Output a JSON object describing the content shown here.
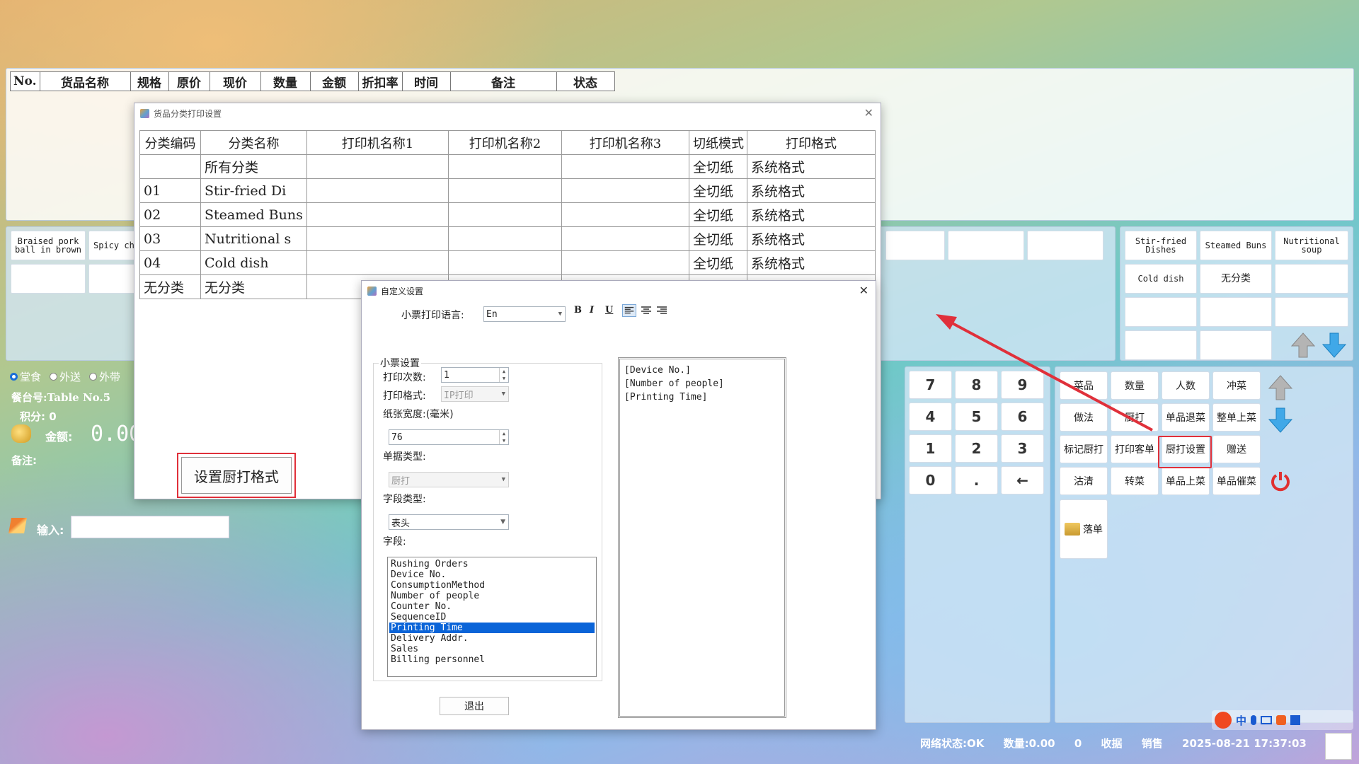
{
  "order_table": {
    "columns": [
      "No.",
      "货品名称",
      "规格",
      "原价",
      "现价",
      "数量",
      "金额",
      "折扣率",
      "时间",
      "备注",
      "状态"
    ]
  },
  "left_tiles": [
    "Braised pork ball in brown",
    "Spicy ch"
  ],
  "category_tiles": [
    "Stir-fried Dishes",
    "Steamed Buns",
    "Nutritional soup",
    "Cold dish",
    "无分类"
  ],
  "order_type": {
    "options": [
      "堂食",
      "外送",
      "外带"
    ],
    "selected": "堂食"
  },
  "info": {
    "table_label": "餐台号:",
    "table_value": "Table No.5",
    "points_label": "积分:",
    "points_value": "0",
    "amount_label": "金额:",
    "amount_value": "0.00",
    "remark_label": "备注:"
  },
  "input_label": "输入:",
  "keypad": [
    "7",
    "8",
    "9",
    "4",
    "5",
    "6",
    "1",
    "2",
    "3",
    "0",
    ".",
    "←"
  ],
  "func_buttons": [
    "菜品",
    "数量",
    "人数",
    "冲菜",
    "做法",
    "厨打",
    "单品退菜",
    "整单上菜",
    "标记厨打",
    "打印客单",
    "厨打设置",
    "赠送",
    "沽清",
    "转菜",
    "单品上菜",
    "单品催菜"
  ],
  "luodan_label": "落单",
  "status_bar": {
    "network": "网络状态:OK",
    "quantity": "数量:0.00",
    "count": "0",
    "cashier": "收据",
    "sales": "销售",
    "datetime": "2025-08-21 17:37:03"
  },
  "ime_label": "中",
  "category_dialog": {
    "title": "货品分类打印设置",
    "columns": [
      "分类编码",
      "分类名称",
      "打印机名称1",
      "打印机名称2",
      "打印机名称3",
      "切纸模式",
      "打印格式"
    ],
    "rows": [
      {
        "code": "",
        "name": "所有分类",
        "cut": "全切纸",
        "format": "系统格式"
      },
      {
        "code": "01",
        "name": "Stir-fried Di",
        "cut": "全切纸",
        "format": "系统格式"
      },
      {
        "code": "02",
        "name": "Steamed Buns",
        "cut": "全切纸",
        "format": "系统格式"
      },
      {
        "code": "03",
        "name": "Nutritional s",
        "cut": "全切纸",
        "format": "系统格式"
      },
      {
        "code": "04",
        "name": "Cold dish",
        "cut": "全切纸",
        "format": "系统格式"
      },
      {
        "code": "无分类",
        "name": "无分类",
        "cut": "",
        "format": ""
      }
    ],
    "set_button": "设置厨打格式"
  },
  "custom_dialog": {
    "title": "自定义设置",
    "lang_label": "小票打印语言:",
    "lang_value": "En",
    "format_buttons": [
      "B",
      "I",
      "U"
    ],
    "group_label": "小票设置",
    "print_count_label": "打印次数:",
    "print_count_value": "1",
    "print_format_label": "打印格式:",
    "print_format_value": "IP打印",
    "paper_width_label": "纸张宽度:(毫米)",
    "paper_width_value": "76",
    "doc_type_label": "单据类型:",
    "doc_type_value": "厨打",
    "field_type_label": "字段类型:",
    "field_type_value": "表头",
    "fields_label": "字段:",
    "fields": [
      "Rushing Orders",
      "Device No.",
      "ConsumptionMethod",
      "Number of people",
      "Counter No.",
      "SequenceID",
      "Printing Time",
      "Delivery Addr.",
      "Sales",
      "Billing personnel"
    ],
    "selected_field": "Printing Time",
    "preview_lines": [
      "[Device No.]",
      "[Number of people]",
      "[Printing Time]"
    ],
    "exit_button": "退出"
  },
  "colors": {
    "highlight_box": "#e0303a",
    "selected_row": "#0a64d8",
    "arrow_up": "#a8a8a8",
    "arrow_down": "#3aa0e0"
  }
}
